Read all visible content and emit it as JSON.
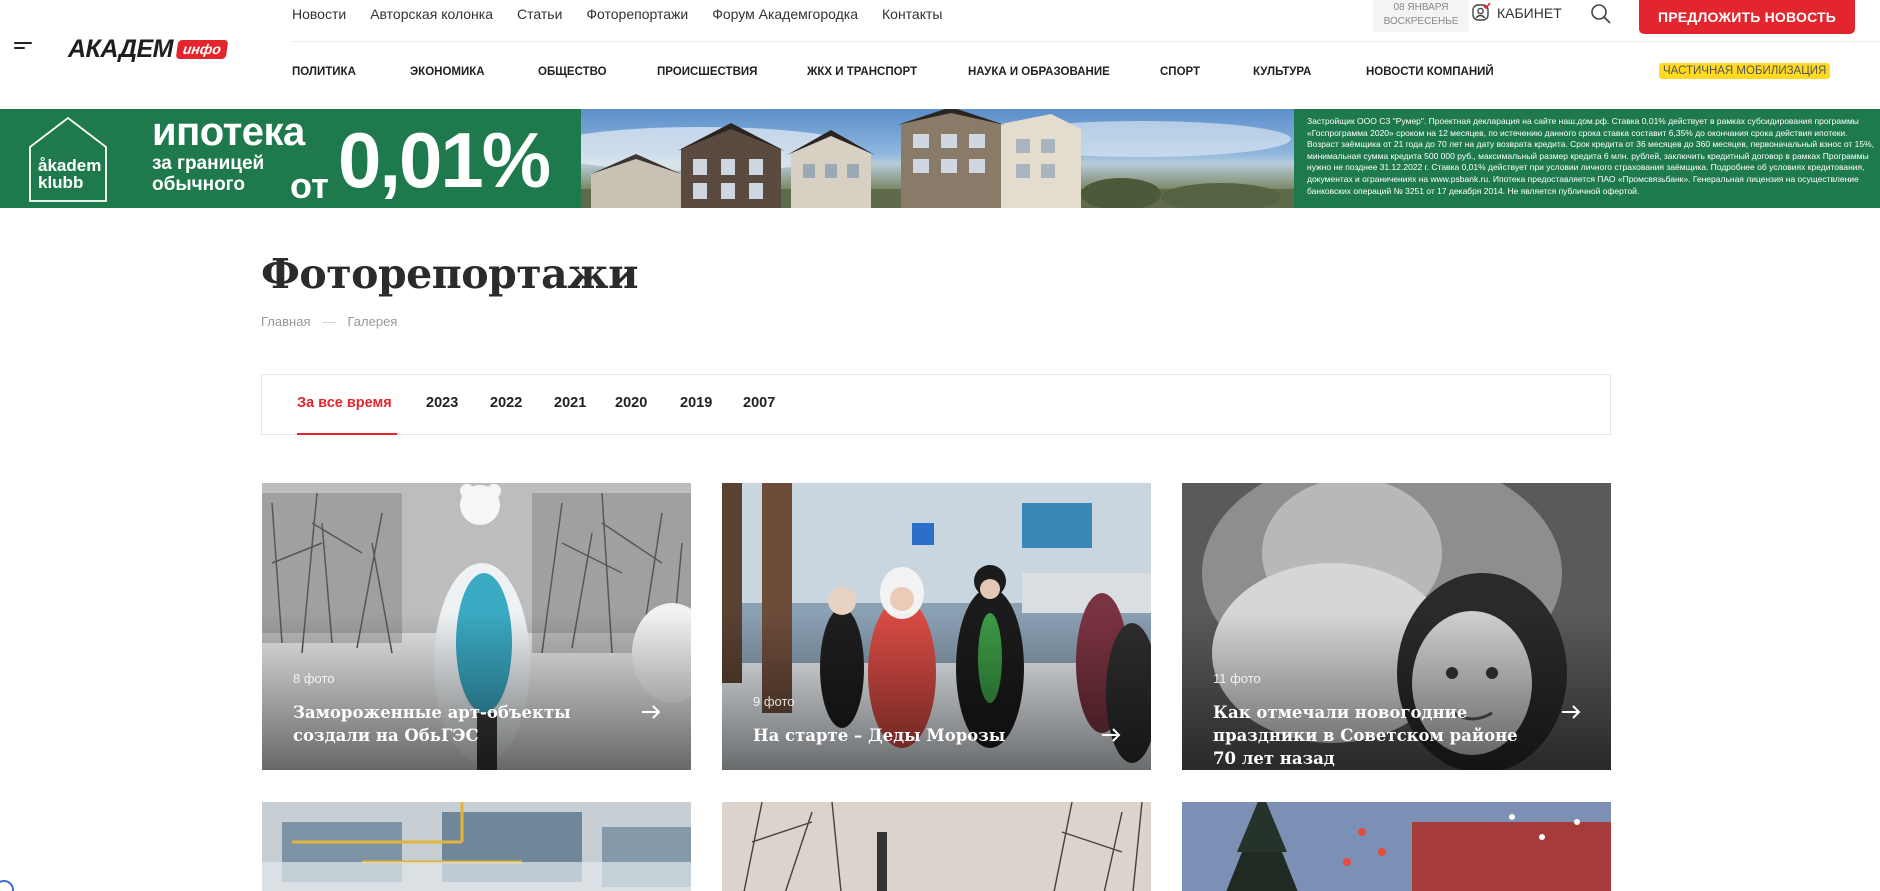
{
  "header": {
    "logo_main": "АКАДЕМ",
    "logo_badge": "инфо",
    "top_nav": [
      "Новости",
      "Авторская колонка",
      "Статьи",
      "Фоторепортажи",
      "Форум Академгородка",
      "Контакты"
    ],
    "date_line1": "08 января",
    "date_line2": "воскресенье",
    "cabinet_label": "Кабинет",
    "suggest_button": "Предложить новость",
    "categories": [
      "Политика",
      "Экономика",
      "Общество",
      "Происшествия",
      "ЖКХ и транспорт",
      "Наука и образование",
      "Спорт",
      "Культура",
      "Новости компаний"
    ],
    "mobilization_badge": "Частичная мобилизация"
  },
  "banner": {
    "logo_line1": "åkadem",
    "logo_line2": "klubb",
    "headline_1": "ипотека",
    "headline_2": "за границей",
    "headline_3": "обычного",
    "headline_ot": "от",
    "headline_rate": "0,01%",
    "fineprint": "Застройщик ООО СЗ \"Румер\". Проектная декларация на сайте наш.дом.рф. Ставка 0,01% действует в рамках субсидирования программы «Госпрограмма 2020» сроком на 12 месяцев, по истечению данного срока ставка составит 6,35% до окончания срока действия ипотеки. Возраст заёмщика от 21 года до 70 лет на дату возврата кредита. Срок кредита от 36 месяцев до 360 месяцев, первоначальный взнос от 15%, минимальная сумма кредита 500 000 руб., максимальный размер кредита 6 млн. рублей, заключить кредитный договор в рамках Программы нужно не позднее 31.12.2022 г. Ставка 0,01% действует при условии личного страхования заёмщика. Подробнее об условиях кредитования, документах и ограничениях на www.psbank.ru. Ипотека предоставляется ПАО «Промсвязьбанк». Генеральная лицензия на осуществление банковских операций № 3251 от 17 декабря 2014. Не является публичной офертой."
  },
  "page": {
    "title": "Фоторепортажи",
    "breadcrumb": [
      "Главная",
      "Галерея"
    ],
    "filters": [
      "За все время",
      "2023",
      "2022",
      "2021",
      "2020",
      "2019",
      "2007"
    ]
  },
  "cards": [
    {
      "count": "8 фото",
      "title": "Замороженные арт-объекты создали на ОбьГЭС"
    },
    {
      "count": "9 фото",
      "title": "На старте – Деды Морозы"
    },
    {
      "count": "11 фото",
      "title": "Как отмечали новогодние праздники в Советском районе 70 лет назад"
    }
  ],
  "colors": {
    "accent": "#e3262e",
    "banner_green": "#1e7a4c",
    "mobilization_yellow": "#fedb22"
  }
}
